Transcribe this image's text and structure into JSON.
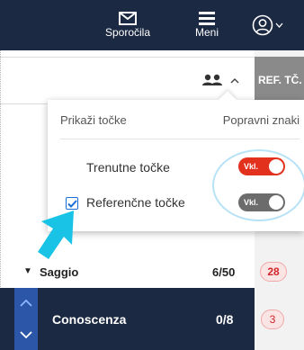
{
  "nav": {
    "messages_label": "Sporočila",
    "menu_label": "Meni",
    "icons": {
      "messages": "envelope-icon",
      "menu": "hamburger-icon",
      "profile": "user-circle-icon"
    }
  },
  "table_header": {
    "ref_column": "REF. TČ.",
    "people_toggle_icon": "people-icon"
  },
  "popover": {
    "left_heading": "Prikaži točke",
    "right_heading": "Popravni znaki",
    "options": [
      {
        "label": "Trenutne točke",
        "toggle_label": "Vkl.",
        "toggle_state": "on",
        "toggle_color": "#e2311d"
      },
      {
        "label": "Referenčne točke",
        "checked": true,
        "toggle_label": "Vkl.",
        "toggle_state": "off",
        "toggle_color": "#6c6c6c"
      }
    ]
  },
  "rows": {
    "saggio": {
      "title": "Saggio",
      "score": "6/50",
      "ref": "28",
      "expanded": true
    },
    "conoscenza": {
      "title": "Conoscenza",
      "score": "0/8",
      "ref": "3"
    }
  },
  "colors": {
    "nav_bg": "#1b2942",
    "ref_header_bg": "#8a8a8a",
    "accent_blue": "#2c57a8",
    "badge_red": "#d4252a",
    "cursor_cyan": "#19c3e6"
  }
}
